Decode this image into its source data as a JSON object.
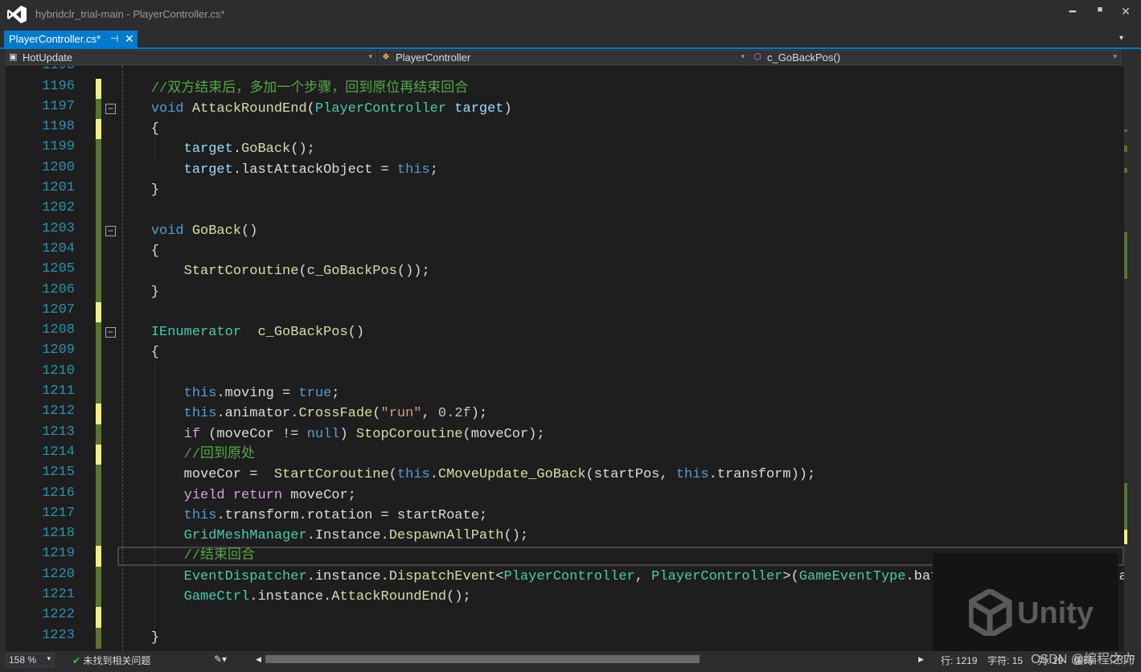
{
  "window": {
    "title": "hybridclr_trial-main - PlayerController.cs*",
    "minimize": "━",
    "maximize": "■",
    "close": "✕"
  },
  "tab": {
    "label": "PlayerController.cs*",
    "pin": "⊣",
    "close": "✕",
    "menu": "▾"
  },
  "nav": {
    "project": "HotUpdate",
    "class": "PlayerController",
    "member": "c_GoBackPos()",
    "dropdown": "▾"
  },
  "editor": {
    "first_partial_line": "1195",
    "current_line": 1219,
    "lines": [
      {
        "n": "1196",
        "mark": "yellow",
        "tokens": [
          [
            "p",
            "    "
          ],
          [
            "cm",
            "//双方结束后，多加一个步骤，回到原位再结束回合"
          ]
        ]
      },
      {
        "n": "1197",
        "mark": "green",
        "fold": "−",
        "tokens": [
          [
            "p",
            "    "
          ],
          [
            "kw",
            "void"
          ],
          [
            "p",
            " "
          ],
          [
            "fn",
            "AttackRoundEnd"
          ],
          [
            "p",
            "("
          ],
          [
            "type",
            "PlayerController"
          ],
          [
            "p",
            " "
          ],
          [
            "var",
            "target"
          ],
          [
            "p",
            ")"
          ]
        ]
      },
      {
        "n": "1198",
        "mark": "yellow",
        "tokens": [
          [
            "p",
            "    {"
          ]
        ]
      },
      {
        "n": "1199",
        "mark": "green",
        "tokens": [
          [
            "p",
            "        "
          ],
          [
            "var",
            "target"
          ],
          [
            "p",
            "."
          ],
          [
            "fn",
            "GoBack"
          ],
          [
            "p",
            "();"
          ]
        ]
      },
      {
        "n": "1200",
        "mark": "green",
        "tokens": [
          [
            "p",
            "        "
          ],
          [
            "var",
            "target"
          ],
          [
            "p",
            ".lastAttackObject = "
          ],
          [
            "kw",
            "this"
          ],
          [
            "p",
            ";"
          ]
        ]
      },
      {
        "n": "1201",
        "mark": "green",
        "tokens": [
          [
            "p",
            "    }"
          ]
        ]
      },
      {
        "n": "1202",
        "mark": "green",
        "tokens": []
      },
      {
        "n": "1203",
        "mark": "green",
        "fold": "−",
        "tokens": [
          [
            "p",
            "    "
          ],
          [
            "kw",
            "void"
          ],
          [
            "p",
            " "
          ],
          [
            "fn",
            "GoBack"
          ],
          [
            "p",
            "()"
          ]
        ]
      },
      {
        "n": "1204",
        "mark": "green",
        "tokens": [
          [
            "p",
            "    {"
          ]
        ]
      },
      {
        "n": "1205",
        "mark": "green",
        "tokens": [
          [
            "p",
            "        "
          ],
          [
            "fn",
            "StartCoroutine"
          ],
          [
            "p",
            "("
          ],
          [
            "fn",
            "c_GoBackPos"
          ],
          [
            "p",
            "());"
          ]
        ]
      },
      {
        "n": "1206",
        "mark": "green",
        "tokens": [
          [
            "p",
            "    }"
          ]
        ]
      },
      {
        "n": "1207",
        "mark": "yellow",
        "tokens": []
      },
      {
        "n": "1208",
        "mark": "green",
        "fold": "−",
        "tokens": [
          [
            "p",
            "    "
          ],
          [
            "type",
            "IEnumerator"
          ],
          [
            "p",
            "  "
          ],
          [
            "fn",
            "c_GoBackPos"
          ],
          [
            "p",
            "()"
          ]
        ]
      },
      {
        "n": "1209",
        "mark": "green",
        "tokens": [
          [
            "p",
            "    {"
          ]
        ]
      },
      {
        "n": "1210",
        "mark": "green",
        "tokens": []
      },
      {
        "n": "1211",
        "mark": "green",
        "tokens": [
          [
            "p",
            "        "
          ],
          [
            "kw",
            "this"
          ],
          [
            "p",
            ".moving = "
          ],
          [
            "kw",
            "true"
          ],
          [
            "p",
            ";"
          ]
        ]
      },
      {
        "n": "1212",
        "mark": "yellow",
        "tokens": [
          [
            "p",
            "        "
          ],
          [
            "kw",
            "this"
          ],
          [
            "p",
            ".animator."
          ],
          [
            "fn",
            "CrossFade"
          ],
          [
            "p",
            "("
          ],
          [
            "str",
            "\"run\""
          ],
          [
            "p",
            ", "
          ],
          [
            "num",
            "0.2f"
          ],
          [
            "p",
            ");"
          ]
        ]
      },
      {
        "n": "1213",
        "mark": "green",
        "tokens": [
          [
            "p",
            "        "
          ],
          [
            "ctl",
            "if"
          ],
          [
            "p",
            " (moveCor != "
          ],
          [
            "kw",
            "null"
          ],
          [
            "p",
            ") "
          ],
          [
            "fn",
            "StopCoroutine"
          ],
          [
            "p",
            "(moveCor);"
          ]
        ]
      },
      {
        "n": "1214",
        "mark": "yellow",
        "tokens": [
          [
            "p",
            "        "
          ],
          [
            "cm",
            "//回到原处"
          ]
        ]
      },
      {
        "n": "1215",
        "mark": "green",
        "tokens": [
          [
            "p",
            "        moveCor =  "
          ],
          [
            "fn",
            "StartCoroutine"
          ],
          [
            "p",
            "("
          ],
          [
            "kw",
            "this"
          ],
          [
            "p",
            "."
          ],
          [
            "fn",
            "CMoveUpdate_GoBack"
          ],
          [
            "p",
            "(startPos, "
          ],
          [
            "kw",
            "this"
          ],
          [
            "p",
            ".transform));"
          ]
        ]
      },
      {
        "n": "1216",
        "mark": "green",
        "tokens": [
          [
            "p",
            "        "
          ],
          [
            "ctl",
            "yield"
          ],
          [
            "p",
            " "
          ],
          [
            "ctl",
            "return"
          ],
          [
            "p",
            " moveCor;"
          ]
        ]
      },
      {
        "n": "1217",
        "mark": "green",
        "tokens": [
          [
            "p",
            "        "
          ],
          [
            "kw",
            "this"
          ],
          [
            "p",
            ".transform.rotation = startRoate;"
          ]
        ]
      },
      {
        "n": "1218",
        "mark": "green",
        "tokens": [
          [
            "p",
            "        "
          ],
          [
            "type",
            "GridMeshManager"
          ],
          [
            "p",
            ".Instance."
          ],
          [
            "fn",
            "DespawnAllPath"
          ],
          [
            "p",
            "();"
          ]
        ]
      },
      {
        "n": "1219",
        "mark": "yellow",
        "tokens": [
          [
            "p",
            "        "
          ],
          [
            "cm",
            "//结束回合"
          ]
        ]
      },
      {
        "n": "1220",
        "mark": "green",
        "tokens": [
          [
            "p",
            "        "
          ],
          [
            "type",
            "EventDispatcher"
          ],
          [
            "p",
            ".instance."
          ],
          [
            "fn",
            "DispatchEvent"
          ],
          [
            "p",
            "<"
          ],
          [
            "type",
            "PlayerController"
          ],
          [
            "p",
            ", "
          ],
          [
            "type",
            "PlayerController"
          ],
          [
            "p",
            ">("
          ],
          [
            "type",
            "GameEventType"
          ],
          [
            "p",
            ".battle_End, "
          ],
          [
            "kw",
            "this"
          ],
          [
            "p",
            ", lastAttackObject);"
          ]
        ]
      },
      {
        "n": "1221",
        "mark": "green",
        "tokens": [
          [
            "p",
            "        "
          ],
          [
            "type",
            "GameCtrl"
          ],
          [
            "p",
            ".instance."
          ],
          [
            "fn",
            "AttackRoundEnd"
          ],
          [
            "p",
            "();"
          ]
        ]
      },
      {
        "n": "1222",
        "mark": "yellow",
        "tokens": []
      },
      {
        "n": "1223",
        "mark": "green",
        "tokens": [
          [
            "p",
            "    }"
          ]
        ]
      }
    ]
  },
  "colors": {
    "accent": "#007acc",
    "yellow_mark": "#efef80",
    "green_mark": "#577430"
  },
  "watermark": {
    "logo": "Unity",
    "credit": "CSDN @编程之力"
  },
  "status": {
    "zoom": "158 %",
    "issues": "未找到相关问题",
    "line": "行: 1219",
    "char": "字符: 15",
    "col": "列: 19",
    "ins": "编码",
    "eol": "CRLF"
  }
}
